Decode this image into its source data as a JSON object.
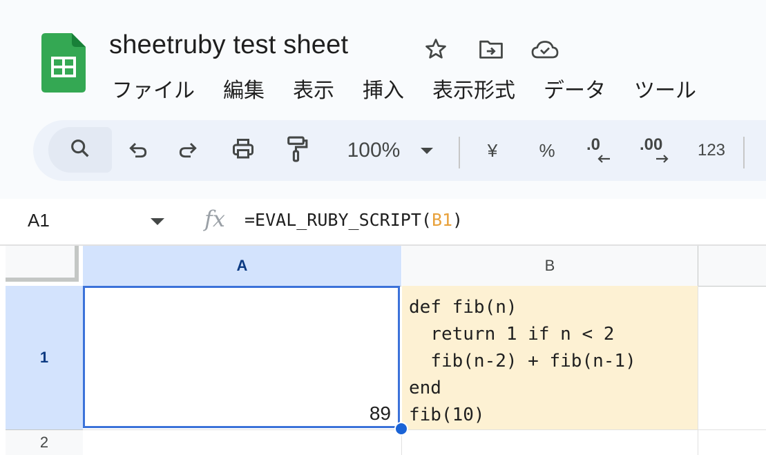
{
  "document": {
    "title": "sheetruby test sheet"
  },
  "menu": {
    "items": [
      "ファイル",
      "編集",
      "表示",
      "挿入",
      "表示形式",
      "データ",
      "ツール"
    ]
  },
  "toolbar": {
    "zoom": "100%",
    "currency": "¥",
    "percent": "%",
    "decrease_decimal": ".0",
    "increase_decimal": ".00",
    "number_format": "123",
    "icons": [
      "search-icon",
      "undo-icon",
      "redo-icon",
      "print-icon",
      "paint-format-icon"
    ]
  },
  "formula_bar": {
    "name_box": "A1",
    "fx_label": "fx",
    "formula_prefix": "=EVAL_RUBY_SCRIPT(",
    "formula_ref": "B1",
    "formula_suffix": ")"
  },
  "grid": {
    "columns": [
      "A",
      "B"
    ],
    "rows": [
      "1",
      "2"
    ],
    "selected_cell": "A1",
    "cells": {
      "A1": "89",
      "B1_lines": [
        "def fib(n)",
        "  return 1 if n < 2",
        "  fib(n-2) + fib(n-1)",
        "end",
        "fib(10)"
      ]
    }
  },
  "colors": {
    "accent": "#3b72d9",
    "selection_header": "#d3e3fd",
    "cell_b1_fill": "#fdf1d3",
    "formula_ref": "#e8a13a",
    "sheets_green": "#1e8e3e"
  }
}
